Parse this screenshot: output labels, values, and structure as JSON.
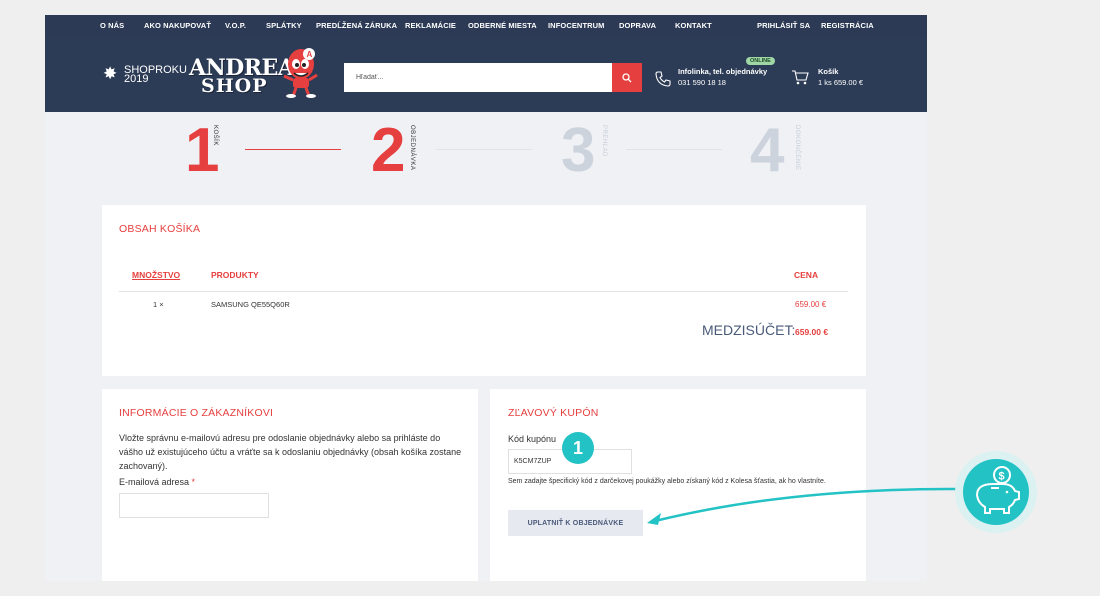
{
  "topnav": {
    "items": [
      "O NÁS",
      "AKO NAKUPOVAŤ",
      "V.O.P.",
      "SPLÁTKY",
      "PREDĹŽENÁ ZÁRUKA",
      "REKLAMÁCIE",
      "ODBERNÉ MIESTA",
      "INFOCENTRUM",
      "DOPRAVA",
      "KONTAKT"
    ],
    "login": "PRIHLÁSIŤ SA",
    "register": "REGISTRÁCIA"
  },
  "header": {
    "award_line1": "SHOPROKU",
    "award_line2": "2019",
    "logo_line1": "ANDREA",
    "logo_line2": "SHOP",
    "search_placeholder": "Hľadať...",
    "infoline_title": "Infolinka, tel. objednávky",
    "infoline_phone": "031 590 18 18",
    "online_badge": "ONLINE",
    "cart_title": "Košík",
    "cart_summary": "1 ks 659.00 €"
  },
  "steps": [
    {
      "number": "1",
      "label": "KOŠÍK"
    },
    {
      "number": "2",
      "label": "OBJEDNÁVKA"
    },
    {
      "number": "3",
      "label": "PREHĽAD"
    },
    {
      "number": "4",
      "label": "DOKONČENIE"
    }
  ],
  "cart": {
    "heading": "OBSAH KOŠÍKA",
    "col_qty": "MNOŽSTVO",
    "col_products": "PRODUKTY",
    "col_price": "CENA",
    "rows": [
      {
        "qty": "1 ×",
        "product": "SAMSUNG QE55Q60R",
        "price": "659.00 €"
      }
    ],
    "subtotal_label": "MEDZISÚČET:",
    "subtotal_value": "659.00 €"
  },
  "customer": {
    "heading": "INFORMÁCIE O ZÁKAZNÍKOVI",
    "intro": "Vložte správnu e-mailovú adresu pre odoslanie objednávky alebo sa prihláste do vášho už existujúceho účtu a vráťte sa k odoslaniu objednávky (obsah košíka zostane zachovaný).",
    "email_label": "E-mailová adresa",
    "required_mark": "*",
    "email_value": ""
  },
  "coupon": {
    "heading": "ZĽAVOVÝ KUPÓN",
    "code_label": "Kód kupónu",
    "code_value": "K5CM7ZUP",
    "hint": "Sem zadajte špecifický kód z darčekovej poukážky alebo získaný kód z Kolesa šťastia, ak ho vlastníte.",
    "apply_button": "UPLATNIŤ K OBJEDNÁVKE"
  },
  "annotation": {
    "badge_number": "1",
    "icon": "piggy-bank-dollar-icon"
  },
  "colors": {
    "navy": "#2c3b56",
    "accent_red": "#e5403f",
    "step_inactive": "#cdd3dc",
    "teal": "#23c2c4"
  }
}
